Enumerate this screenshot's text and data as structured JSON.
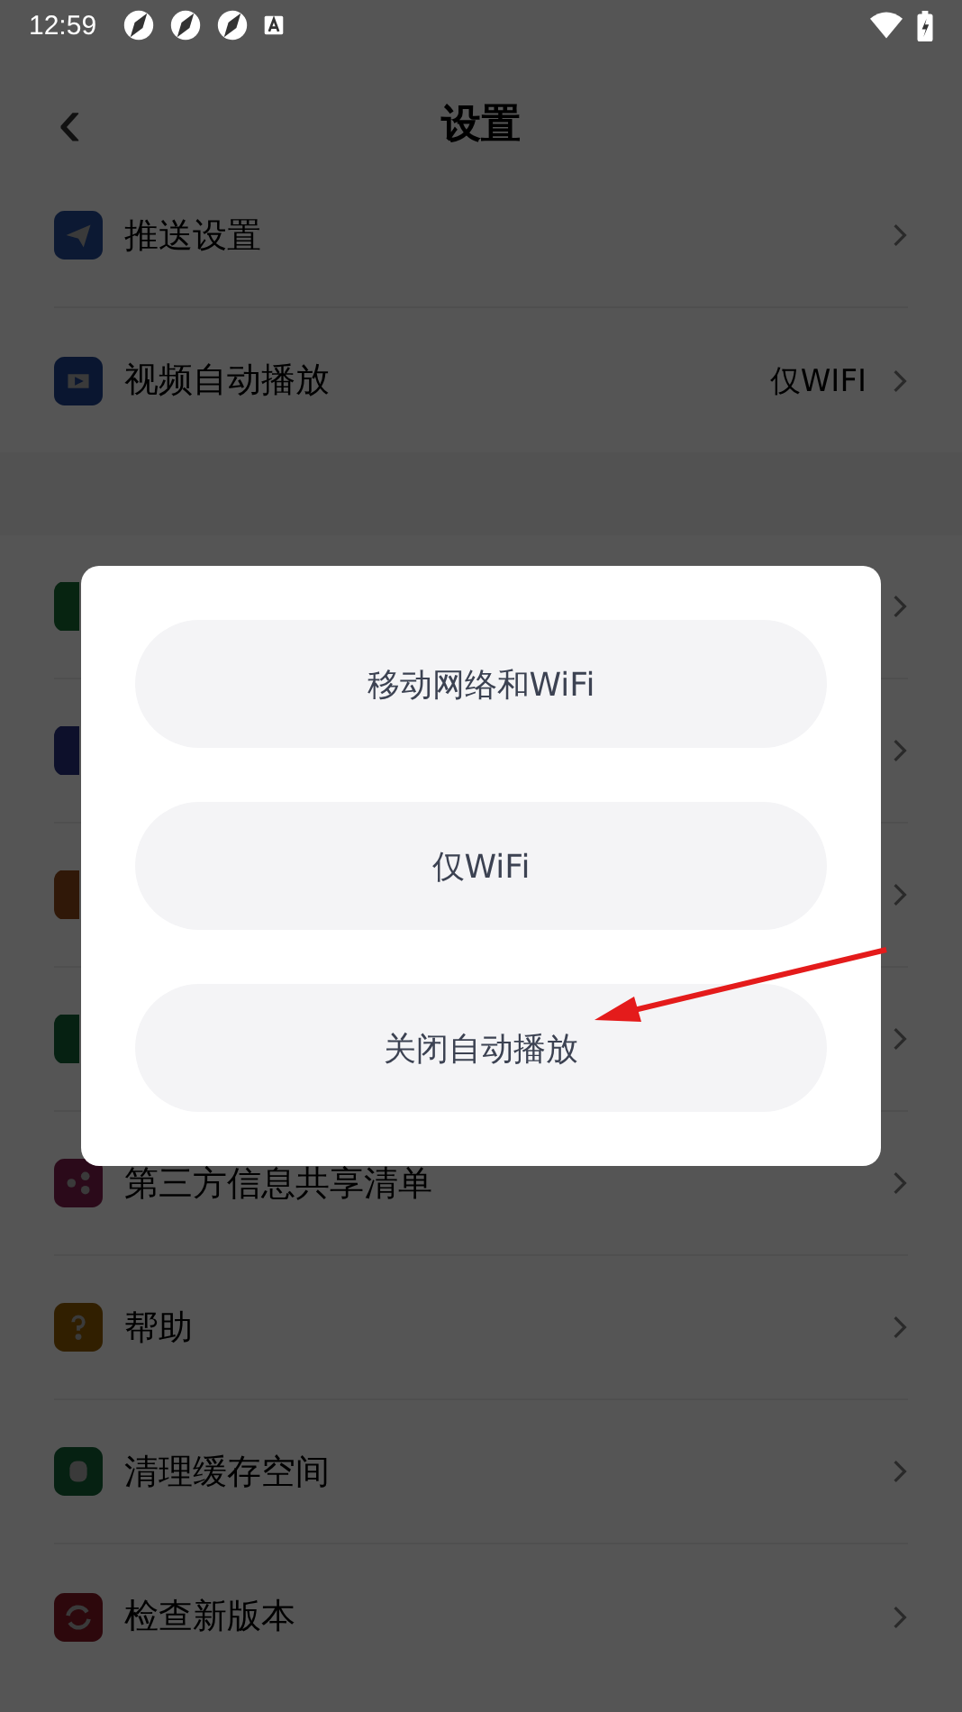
{
  "status_bar": {
    "time": "12:59"
  },
  "header": {
    "back": "‹",
    "title": "设置"
  },
  "settings_groups": [
    [
      {
        "label": "推送设置",
        "color": "#0c1933",
        "kind": "plane"
      },
      {
        "label": "视频自动播放",
        "value": "仅WIFI",
        "color": "#0a1630",
        "kind": "play"
      }
    ],
    [
      {
        "color": "#072411"
      },
      {
        "color": "#0d102b"
      },
      {
        "color": "#301808"
      },
      {
        "color": "#062112"
      },
      {
        "label": "第三方信息共享清单",
        "color": "#2b0a1a",
        "kind": "share"
      },
      {
        "label": "帮助",
        "color": "#311f00",
        "kind": "help"
      },
      {
        "label": "清理缓存空间",
        "color": "#062112",
        "kind": "cylinder"
      },
      {
        "label": "检查新版本",
        "color": "#2d080c",
        "kind": "refresh"
      }
    ]
  ],
  "dialog": {
    "options": [
      {
        "label": "移动网络和WiFi"
      },
      {
        "label": "仅WiFi"
      },
      {
        "label": "关闭自动播放"
      }
    ]
  }
}
